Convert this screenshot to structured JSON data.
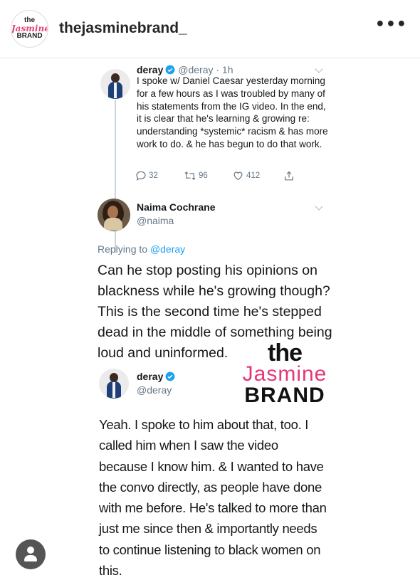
{
  "instagram": {
    "avatar_logo": {
      "line1": "the",
      "line2": "Jasmine",
      "line3": "BRAND"
    },
    "username": "thejasminebrand_",
    "more_label": "•••"
  },
  "tweet1": {
    "name": "deray",
    "handle": "@deray · 1h",
    "text": "I spoke w/ Daniel Caesar yesterday morning for a few hours as I was troubled by many of his statements from the IG video. In the end, it is clear that he's learning & growing re: understanding *systemic* racism & has more work to do. & he has begun to do that work.",
    "replies": "32",
    "retweets": "96",
    "likes": "412"
  },
  "tweet2": {
    "name": "Naima Cochrane",
    "handle": "@naima",
    "replying_prefix": "Replying to",
    "replying_to": "@deray",
    "text": "Can he stop posting his opinions on blackness while he's growing though? This is the second time he's stepped dead in the middle of something being loud and uninformed."
  },
  "tweet3": {
    "name": "deray",
    "handle": "@deray",
    "text": "Yeah. I spoke to him about that, too. I called him when I saw the video because I know him. & I wanted to have the convo directly, as people have done with me before. He's talked to more than just me since then & importantly needs to continue listening to black women on this."
  },
  "watermark": {
    "line1": "the",
    "line2": "Jasmine",
    "line3": "BRAND"
  },
  "colors": {
    "verified_blue": "#1da1f2",
    "brand_pink": "#e3377a",
    "secondary_text": "#657786"
  },
  "icons": [
    "more-icon",
    "verified-icon",
    "reply-icon",
    "retweet-icon",
    "like-icon",
    "share-icon",
    "chevron-down-icon",
    "user-icon"
  ]
}
